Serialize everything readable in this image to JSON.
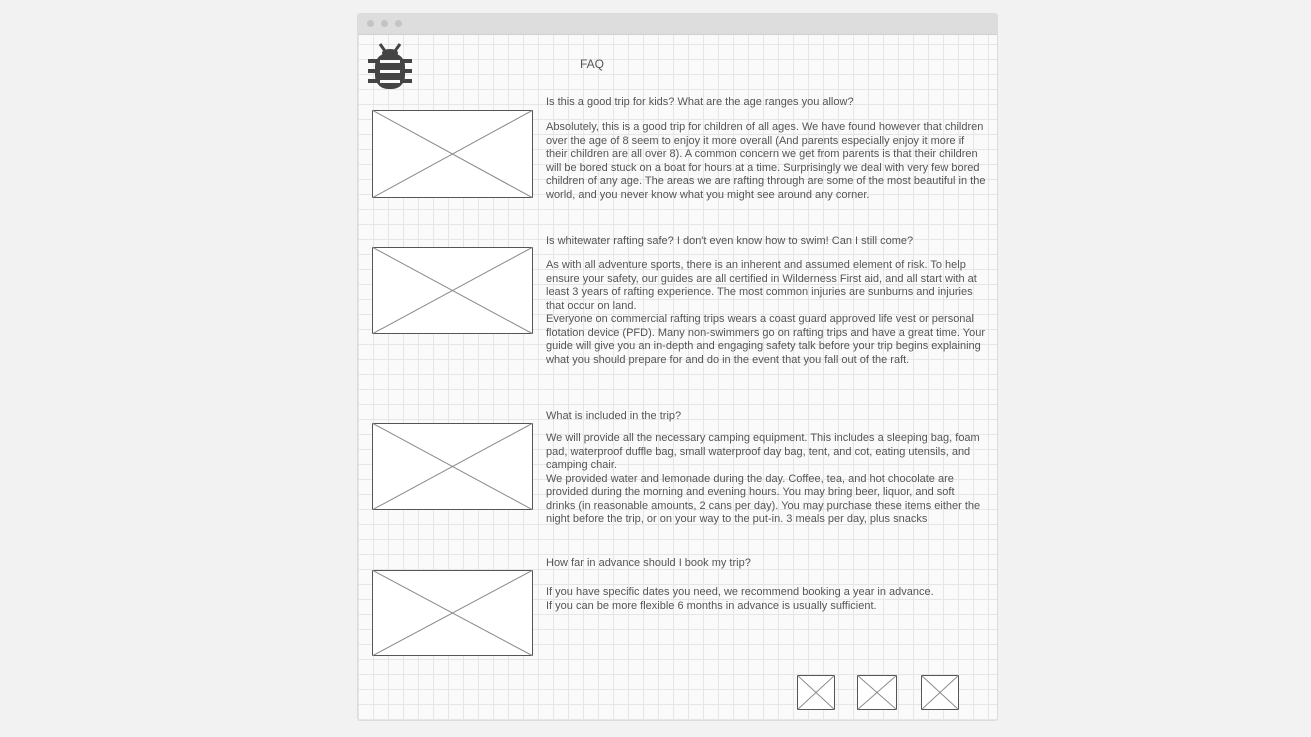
{
  "nav": {
    "faq_label": "FAQ"
  },
  "logo": {
    "icon": "bug-icon",
    "color": "#444444"
  },
  "faq": [
    {
      "question": "Is this a good trip for kids? What are the age ranges you allow?",
      "answer": [
        "Absolutely, this is a good trip for children of all ages. We have found however that children over the age of 8 seem to enjoy it more overall (And parents especially enjoy it more if their children are all over 8). A common concern we get from parents is that their children will be bored stuck on a boat for hours at a time. Surprisingly we deal with very few bored children of any age. The areas we are rafting through are some of the most beautiful in the world, and you never know what you might see around any corner."
      ]
    },
    {
      "question": "Is whitewater rafting safe? I don't even know how to swim! Can I still come?",
      "answer": [
        "As with all adventure sports, there is an inherent and assumed element of risk. To help ensure your safety, our guides are all certified in Wilderness First aid, and all start with at least 3 years of rafting experience. The most common injuries are sunburns and injuries that occur on land.",
        "Everyone on commercial rafting trips wears a coast guard approved life vest or personal flotation device (PFD). Many non-swimmers go on rafting trips and have a great time. Your guide will give you an in-depth and engaging safety talk before your trip begins explaining what you should prepare for and do in the event that you fall out of the raft."
      ]
    },
    {
      "question": "What is included in the trip?",
      "answer": [
        "We will provide all the necessary camping equipment. This includes a sleeping bag, foam pad, waterproof duffle bag, small waterproof day bag, tent, and cot, eating utensils, and camping chair.",
        "We provided water and lemonade during the day. Coffee, tea, and hot chocolate are provided during the morning and evening hours. You may bring beer, liquor, and soft drinks (in reasonable amounts, 2 cans per day). You may purchase these items either the night before the trip, or on your way to the put-in. 3 meals per day, plus snacks"
      ]
    },
    {
      "question": "How far in advance should I book my trip?",
      "answer": [
        "If you have specific dates you need, we recommend booking a year in advance.",
        "If you can be more flexible 6 months in advance is usually sufficient."
      ]
    }
  ]
}
